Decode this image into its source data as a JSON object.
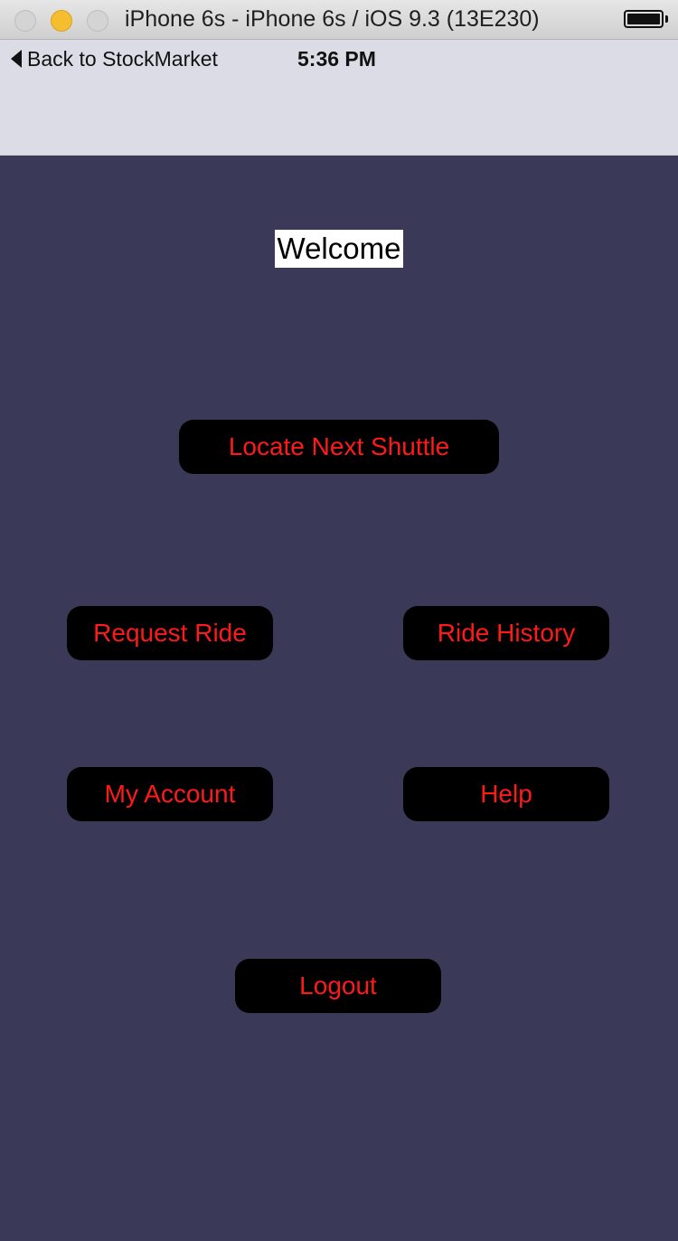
{
  "window": {
    "title": "iPhone 6s - iPhone 6s / iOS 9.3 (13E230)"
  },
  "statusbar": {
    "back_label": "Back to StockMarket",
    "time": "5:36 PM",
    "battery_level": 1.0
  },
  "main": {
    "welcome": "Welcome",
    "buttons": {
      "locate": "Locate Next Shuttle",
      "request_ride": "Request Ride",
      "ride_history": "Ride History",
      "my_account": "My Account",
      "help": "Help",
      "logout": "Logout"
    }
  },
  "colors": {
    "background": "#3a3a58",
    "button_bg": "#000000",
    "button_text": "#ff1a1a",
    "nav_bar": "#dcdce6"
  }
}
